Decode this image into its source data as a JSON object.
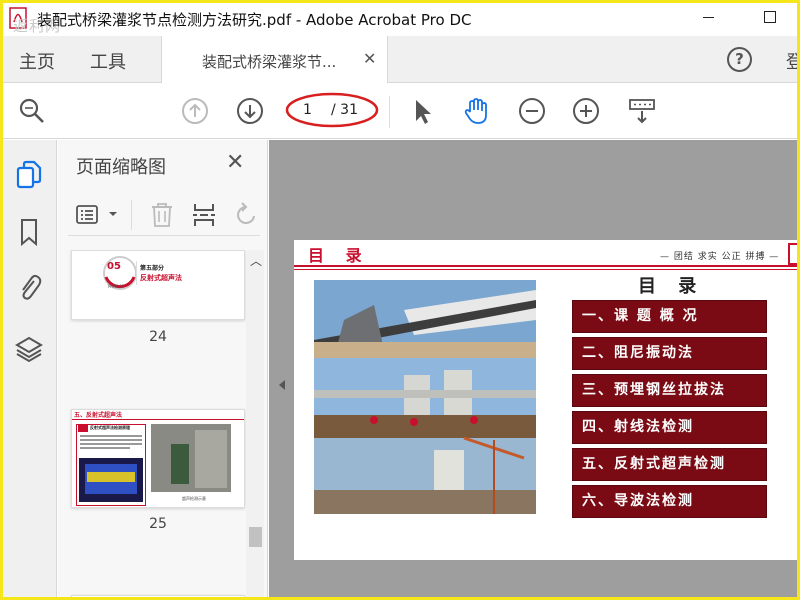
{
  "window": {
    "watermark": "返利网",
    "title": "装配式桥梁灌浆节点检测方法研究.pdf - Adobe Acrobat Pro DC"
  },
  "menu": {
    "home": "主页",
    "tools": "工具",
    "doc_tab": "装配式桥梁灌浆节...",
    "login": "登"
  },
  "toolbar": {
    "page_current": "1",
    "page_total": "/ 31"
  },
  "panel": {
    "title": "页面缩略图"
  },
  "thumbnails": [
    {
      "number": "24",
      "badge": "05",
      "part_title": "第五部分",
      "part_subtitle": "反射式超声法",
      "part_label": "PART 05"
    },
    {
      "number": "25",
      "header": "五、反射式超声法",
      "box_title": "反射式超声法检测原理",
      "caption": "超声检测示意"
    }
  ],
  "document": {
    "header_title": "目 录",
    "motto": "— 团结 求实 公正 拼搏 —",
    "toc_heading": "目 录",
    "toc_items": [
      "一、课 题 概 况",
      "二、阻尼振动法",
      "三、预埋钢丝拉拔法",
      "四、射线法检测",
      "五、反射式超声检测",
      "六、导波法检测"
    ]
  },
  "colors": {
    "accent_red": "#c8102e",
    "toc_bg": "#7a0b14",
    "highlight_blue": "#1473e6",
    "frame_yellow": "#f5e61a"
  }
}
